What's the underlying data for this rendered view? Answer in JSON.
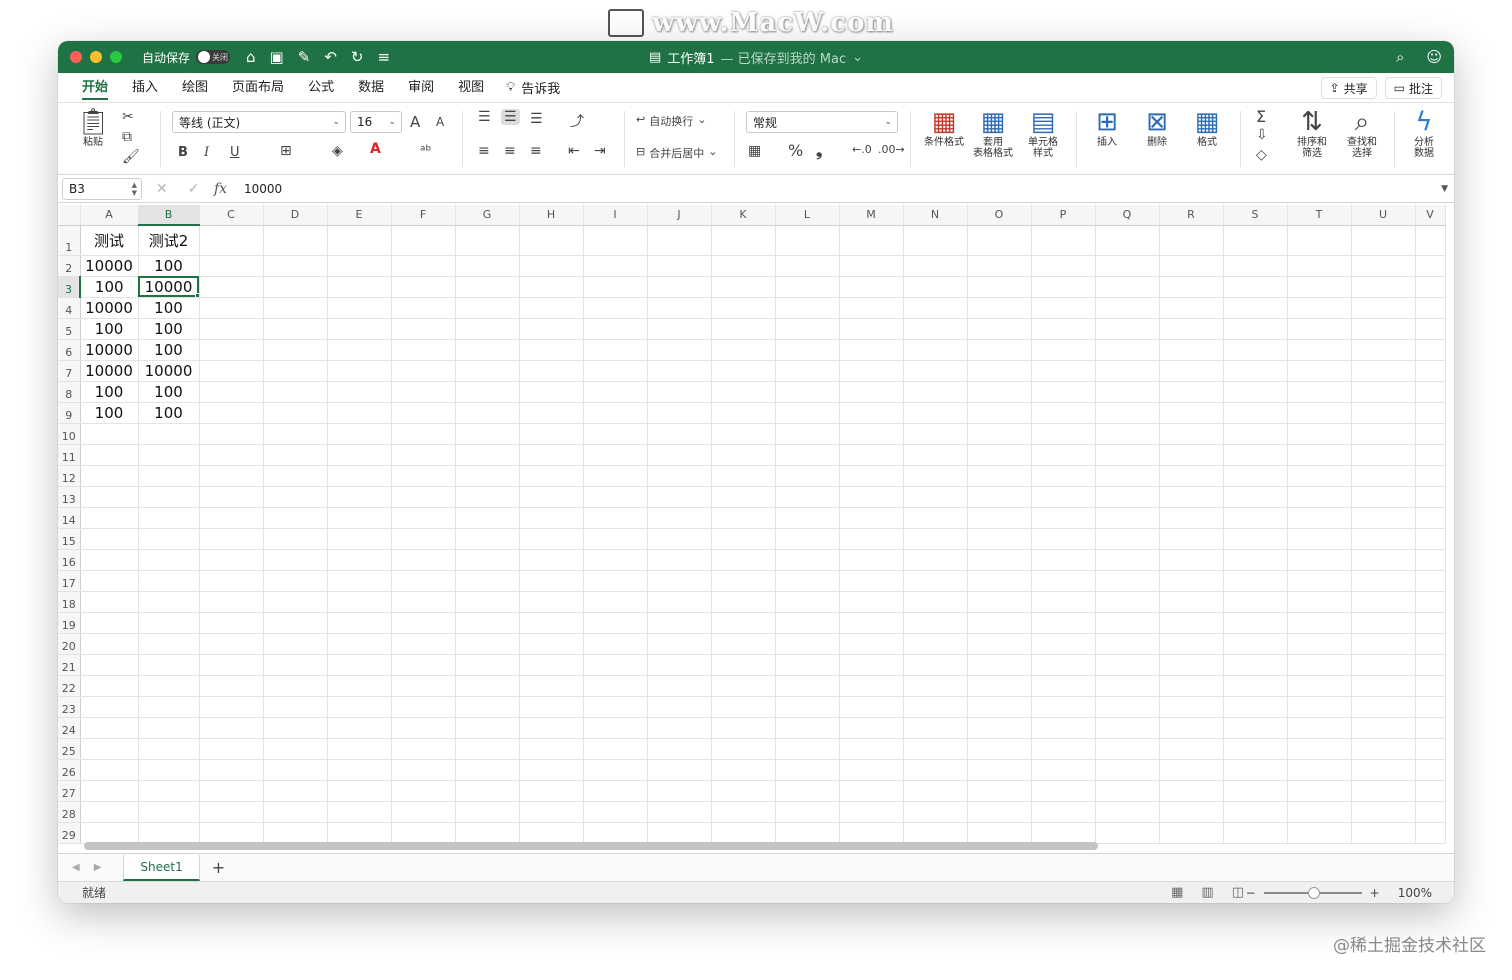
{
  "watermark": {
    "site": "www.MacW.com",
    "credit": "@稀土掘金技术社区"
  },
  "titlebar": {
    "autosave_label": "自动保存",
    "autosave_state": "关闭",
    "doc_title": "工作簿1",
    "doc_subtitle": "— 已保存到我的 Mac",
    "doc_caret": "⌄"
  },
  "tabs": {
    "items": [
      "开始",
      "插入",
      "绘图",
      "页面布局",
      "公式",
      "数据",
      "审阅",
      "视图"
    ],
    "tell_me": "告诉我",
    "share": "共享",
    "comments": "批注"
  },
  "ribbon": {
    "paste": "粘贴",
    "font_name": "等线 (正文)",
    "font_size": "16",
    "wrap_text": "自动换行",
    "merge_center": "合并后居中",
    "number_format": "常规",
    "percent": "%",
    "comma": "❟",
    "cond_format": "条件格式",
    "table_format_1": "套用",
    "table_format_2": "表格格式",
    "cell_style_1": "单元格",
    "cell_style_2": "样式",
    "insert": "插入",
    "delete": "删除",
    "format": "格式",
    "sort_1": "排序和",
    "sort_2": "筛选",
    "find_1": "查找和",
    "find_2": "选择",
    "analyze_1": "分析",
    "analyze_2": "数据",
    "bold": "B",
    "italic": "I",
    "underline": "U",
    "grow_font": "A",
    "shrink_font": "A"
  },
  "formula_bar": {
    "name_box": "B3",
    "fx": "fx",
    "value": "10000"
  },
  "sheet": {
    "columns": [
      "A",
      "B",
      "C",
      "D",
      "E",
      "F",
      "G",
      "H",
      "I",
      "J",
      "K",
      "L",
      "M",
      "N",
      "O",
      "P",
      "Q",
      "R",
      "S",
      "T",
      "U",
      "V"
    ],
    "rows": [
      "1",
      "2",
      "3",
      "4",
      "5",
      "6",
      "7",
      "8",
      "9",
      "10",
      "11",
      "12",
      "13",
      "14",
      "15",
      "16",
      "17",
      "18",
      "19",
      "20",
      "21",
      "22",
      "23",
      "24",
      "25",
      "26",
      "27",
      "28",
      "29"
    ],
    "data": [
      [
        "测试",
        "测试2"
      ],
      [
        "10000",
        "100"
      ],
      [
        "100",
        "10000"
      ],
      [
        "10000",
        "100"
      ],
      [
        "100",
        "100"
      ],
      [
        "10000",
        "100"
      ],
      [
        "10000",
        "10000"
      ],
      [
        "100",
        "100"
      ],
      [
        "100",
        "100"
      ]
    ],
    "active_cell": "B3",
    "tab_name": "Sheet1",
    "add_sheet": "+"
  },
  "status": {
    "ready": "就绪",
    "zoom": "100%",
    "zoom_minus": "−",
    "zoom_plus": "+"
  }
}
